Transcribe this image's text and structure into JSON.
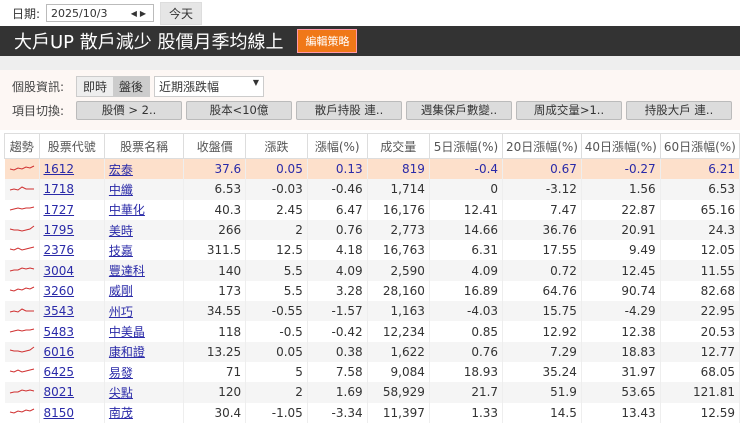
{
  "datebar": {
    "label": "日期:",
    "date": "2025/10/3",
    "today": "今天"
  },
  "title": {
    "text": "大戶UP 散戶減少  股價月季均線上",
    "edit": "編輯策略"
  },
  "info": {
    "label": "個股資訊:",
    "realtime": "即時",
    "after": "盤後",
    "select": "近期漲跌幅"
  },
  "switch": {
    "label": "項目切換:",
    "items": [
      "股價 > 2..",
      "股本<10億",
      "散戶持股 連..",
      "週集保戶數變..",
      "周成交量>1..",
      "持股大戶 連.."
    ]
  },
  "table": {
    "headers": [
      "趨勢",
      "股票代號",
      "股票名稱",
      "收盤價",
      "漲跌",
      "漲幅(%)",
      "成交量",
      "5日漲幅(%)",
      "20日漲幅(%)",
      "40日漲幅(%)",
      "60日漲幅(%)"
    ],
    "rows": [
      [
        "1612",
        "宏泰",
        "37.6",
        "0.05",
        "0.13",
        "819",
        "-0.4",
        "0.67",
        "-0.27",
        "6.21"
      ],
      [
        "1718",
        "中纖",
        "6.53",
        "-0.03",
        "-0.46",
        "1,714",
        "0",
        "-3.12",
        "1.56",
        "6.53"
      ],
      [
        "1727",
        "中華化",
        "40.3",
        "2.45",
        "6.47",
        "16,176",
        "12.41",
        "7.47",
        "22.87",
        "65.16"
      ],
      [
        "1795",
        "美時",
        "266",
        "2",
        "0.76",
        "2,773",
        "14.66",
        "36.76",
        "20.91",
        "24.3"
      ],
      [
        "2376",
        "技嘉",
        "311.5",
        "12.5",
        "4.18",
        "16,763",
        "6.31",
        "17.55",
        "9.49",
        "12.05"
      ],
      [
        "3004",
        "豐達科",
        "140",
        "5.5",
        "4.09",
        "2,590",
        "4.09",
        "0.72",
        "12.45",
        "11.55"
      ],
      [
        "3260",
        "威剛",
        "173",
        "5.5",
        "3.28",
        "28,160",
        "16.89",
        "64.76",
        "90.74",
        "82.68"
      ],
      [
        "3543",
        "州巧",
        "34.55",
        "-0.55",
        "-1.57",
        "1,163",
        "-4.03",
        "15.75",
        "-4.29",
        "22.95"
      ],
      [
        "5483",
        "中美晶",
        "118",
        "-0.5",
        "-0.42",
        "12,234",
        "0.85",
        "12.92",
        "12.38",
        "20.53"
      ],
      [
        "6016",
        "康和證",
        "13.25",
        "0.05",
        "0.38",
        "1,622",
        "0.76",
        "7.29",
        "18.83",
        "12.77"
      ],
      [
        "6425",
        "易發",
        "71",
        "5",
        "7.58",
        "9,084",
        "18.93",
        "35.24",
        "31.97",
        "68.05"
      ],
      [
        "8021",
        "尖點",
        "120",
        "2",
        "1.69",
        "58,929",
        "21.7",
        "51.9",
        "53.65",
        "121.81"
      ],
      [
        "8150",
        "南茂",
        "30.4",
        "-1.05",
        "-3.34",
        "11,397",
        "1.33",
        "14.5",
        "13.43",
        "12.59"
      ]
    ]
  },
  "colors": {
    "accent": "#f07818",
    "highlight": "#fde0cb",
    "trend": "#d03030",
    "link": "#2a2aa8"
  }
}
